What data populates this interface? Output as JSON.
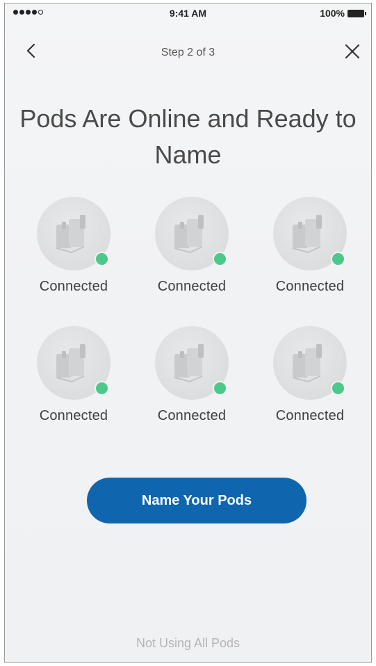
{
  "status_bar": {
    "time": "9:41 AM",
    "battery": "100%"
  },
  "nav": {
    "step": "Step 2 of 3",
    "back_icon": "chevron-left-icon",
    "close_icon": "close-icon"
  },
  "title": "Pods Are Online and Ready to Name",
  "pods": [
    {
      "status": "Connected"
    },
    {
      "status": "Connected"
    },
    {
      "status": "Connected"
    },
    {
      "status": "Connected"
    },
    {
      "status": "Connected"
    },
    {
      "status": "Connected"
    }
  ],
  "cta": {
    "label": "Name Your Pods"
  },
  "footer": {
    "link": "Not Using All Pods"
  },
  "colors": {
    "accent": "#0f66ae",
    "connected": "#4cc98a",
    "muted_text": "#b4b4b4"
  }
}
